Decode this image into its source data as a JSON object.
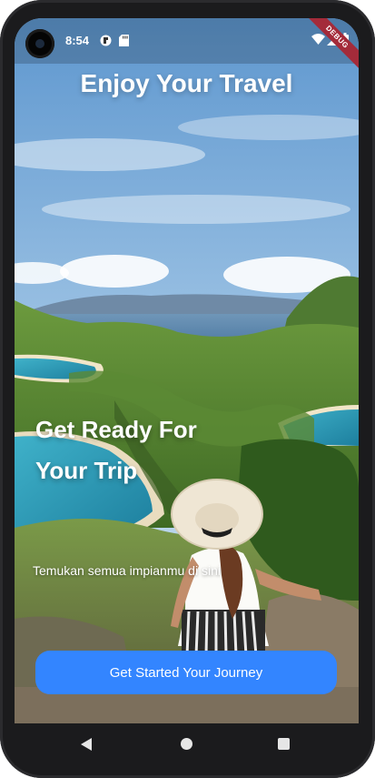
{
  "status_bar": {
    "time": "8:54",
    "debug_label": "DEBUG",
    "icons": [
      "camera-cutout",
      "sim-notification-icon",
      "sd-card-icon",
      "wifi-icon",
      "signal-icon",
      "battery-icon"
    ]
  },
  "main": {
    "title": "Enjoy Your Travel",
    "headline_line1": "Get Ready For",
    "headline_line2": "Your Trip",
    "subtitle": "Temukan semua impianmu di sini",
    "cta_label": "Get Started Your Journey"
  },
  "nav_bar": {
    "icons": [
      "back-icon",
      "home-icon",
      "recents-icon"
    ]
  },
  "colors": {
    "accent": "#3385ff",
    "debug_ribbon": "#a42b3a",
    "device_frame": "#1b1b1d"
  }
}
